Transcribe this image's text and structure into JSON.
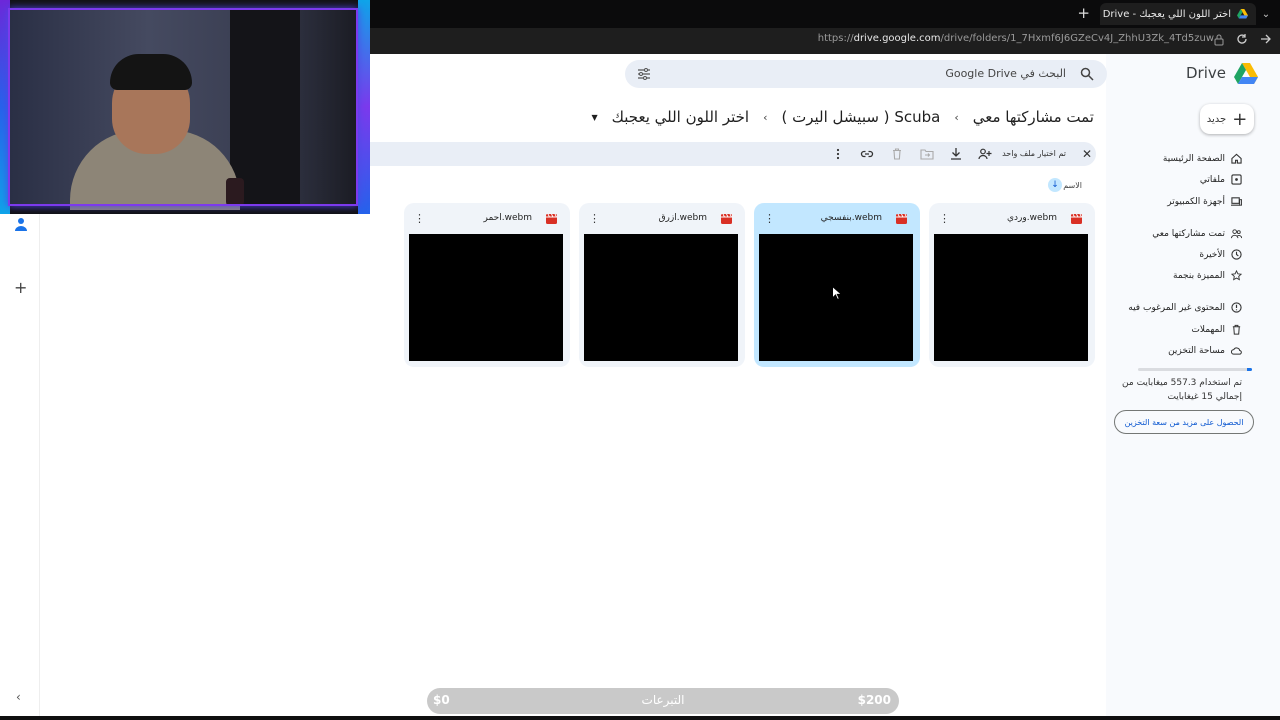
{
  "browser": {
    "tab_title": "اختر اللون اللي يعجبك - Google Drive",
    "tab_close": "✕",
    "new_tab": "+",
    "tab_menu": "⌄",
    "url_prefix": "https://",
    "url_domain": "drive.google.com",
    "url_path": "/drive/folders/1_7Hxmf6J6GZeCv4J_ZhhU3Zk_4Td5zuw"
  },
  "drive": {
    "title": "Drive",
    "search_placeholder": "البحث في Google Drive",
    "new_button": "جديد",
    "new_plus": "+"
  },
  "sidebar": {
    "items": [
      {
        "label": "الصفحة الرئيسية",
        "icon": "home-icon"
      },
      {
        "label": "ملفاتي",
        "icon": "my-drive-icon"
      },
      {
        "label": "أجهزة الكمبيوتر",
        "icon": "computers-icon"
      },
      {
        "label": "تمت مشاركتها معي",
        "icon": "shared-icon"
      },
      {
        "label": "الأخيرة",
        "icon": "recent-icon"
      },
      {
        "label": "المميزة بنجمة",
        "icon": "star-icon"
      },
      {
        "label": "المحتوى غير المرغوب فيه",
        "icon": "spam-icon"
      },
      {
        "label": "المهملات",
        "icon": "trash-icon"
      },
      {
        "label": "مساحة التخزين",
        "icon": "cloud-icon"
      }
    ],
    "storage_used_fraction": 0.04,
    "storage_text": "تم استخدام 557.3 ميغابايت من إجمالي 15 غيغابايت",
    "storage_button": "الحصول على مزيد من سعة التخزين"
  },
  "breadcrumb": {
    "items": [
      "تمت مشاركتها معي",
      "Scuba ( سبيشل اليرت )",
      "اختر اللون اللي يعجبك"
    ],
    "separator": "›",
    "caret": "▼"
  },
  "selection": {
    "close": "✕",
    "text": "تم اختيار ملف واحد"
  },
  "sort": {
    "label": "الاسم",
    "arrow": "↓"
  },
  "files": [
    {
      "name": "وردي.webm",
      "selected": false
    },
    {
      "name": "بنفسجي.webm",
      "selected": true
    },
    {
      "name": "ازرق.webm",
      "selected": false
    },
    {
      "name": "احمر.webm",
      "selected": false
    }
  ],
  "file_more": "⋮",
  "rail": {
    "add": "+",
    "collapse": "‹"
  },
  "donation": {
    "min": "$0",
    "label": "التبرعات",
    "max": "$200"
  },
  "colors": {
    "accent": "#0b57d0",
    "selected_card": "#c2e7ff",
    "card": "#f0f4f9",
    "video_icon": "#d93025"
  }
}
